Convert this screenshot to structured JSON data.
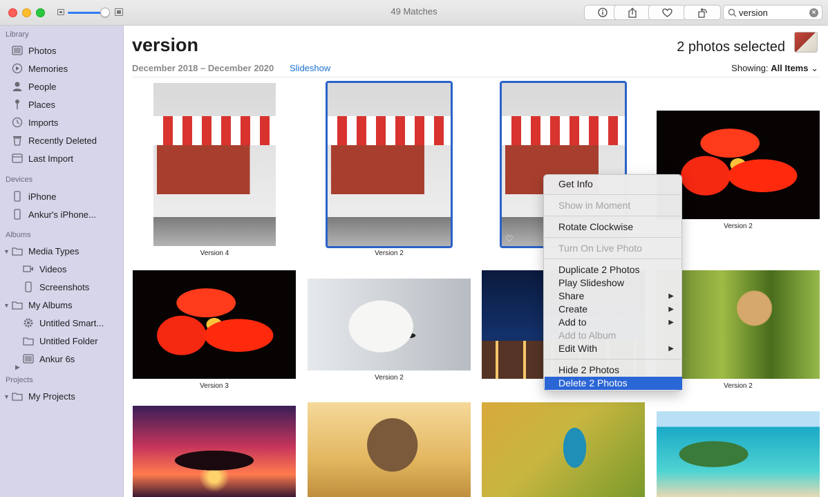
{
  "window": {
    "title": "49 Matches"
  },
  "toolbar": {
    "info_icon": "info-icon",
    "share_icon": "share-icon",
    "heart_icon": "heart-icon",
    "rotate_icon": "rotate-icon",
    "zoom_fraction": 0.9,
    "search_value": "version"
  },
  "sidebar": {
    "library_header": "Library",
    "library": [
      {
        "label": "Photos",
        "icon": "photos-icon"
      },
      {
        "label": "Memories",
        "icon": "memories-icon"
      },
      {
        "label": "People",
        "icon": "people-icon"
      },
      {
        "label": "Places",
        "icon": "places-icon"
      },
      {
        "label": "Imports",
        "icon": "imports-icon"
      },
      {
        "label": "Recently Deleted",
        "icon": "trash-icon"
      },
      {
        "label": "Last Import",
        "icon": "last-import-icon"
      }
    ],
    "devices_header": "Devices",
    "devices": [
      {
        "label": "iPhone",
        "icon": "iphone-icon"
      },
      {
        "label": "Ankur's iPhone...",
        "icon": "iphone-icon"
      }
    ],
    "albums_header": "Albums",
    "albums": {
      "media_types": "Media Types",
      "videos": "Videos",
      "screenshots": "Screenshots",
      "my_albums": "My Albums",
      "untitled_smart": "Untitled Smart...",
      "untitled_folder": "Untitled Folder",
      "ankur_6s": "Ankur 6s"
    },
    "projects_header": "Projects",
    "projects": {
      "my_projects": "My Projects"
    }
  },
  "header": {
    "title": "version",
    "date_range": "December 2018 – December 2020",
    "slideshow": "Slideshow",
    "selected": "2 photos selected",
    "showing_label": "Showing:",
    "showing_value": "All Items",
    "chevron": "⌄"
  },
  "photos": {
    "captions": [
      "Version 4",
      "Version 2",
      "Version 2",
      "Version 3",
      "Version 2",
      "Version 2"
    ]
  },
  "context_menu": {
    "get_info": "Get Info",
    "show_in_moment": "Show in Moment",
    "rotate_clockwise": "Rotate Clockwise",
    "turn_on_live_photo": "Turn On Live Photo",
    "duplicate": "Duplicate 2 Photos",
    "play_slideshow": "Play Slideshow",
    "share": "Share",
    "create": "Create",
    "add_to": "Add to",
    "add_to_album": "Add to Album",
    "edit_with": "Edit With",
    "hide": "Hide 2 Photos",
    "delete": "Delete 2 Photos",
    "submenu_arrow": "▶"
  },
  "colors": {
    "accent": "#2a66d6",
    "sidebar": "#d6d5ea",
    "link": "#1a74d4"
  }
}
